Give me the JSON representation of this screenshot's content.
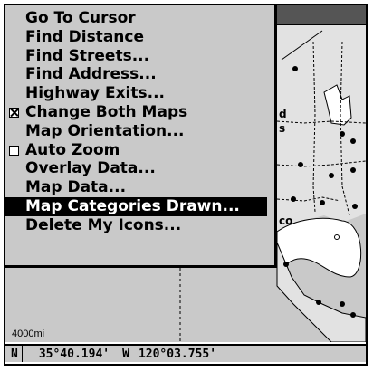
{
  "menu": {
    "items": [
      {
        "label": "Go To Cursor",
        "checkbox": null,
        "selected": false
      },
      {
        "label": "Find Distance",
        "checkbox": null,
        "selected": false
      },
      {
        "label": "Find Streets...",
        "checkbox": null,
        "selected": false
      },
      {
        "label": "Find Address...",
        "checkbox": null,
        "selected": false
      },
      {
        "label": "Highway Exits...",
        "checkbox": null,
        "selected": false
      },
      {
        "label": "Change Both Maps",
        "checkbox": true,
        "selected": false
      },
      {
        "label": "Map Orientation...",
        "checkbox": null,
        "selected": false
      },
      {
        "label": "Auto Zoom",
        "checkbox": false,
        "selected": false
      },
      {
        "label": "Overlay Data...",
        "checkbox": null,
        "selected": false
      },
      {
        "label": "Map Data...",
        "checkbox": null,
        "selected": false
      },
      {
        "label": "Map Categories Drawn...",
        "checkbox": null,
        "selected": true
      },
      {
        "label": "Delete My Icons...",
        "checkbox": null,
        "selected": false
      }
    ]
  },
  "map": {
    "scale_label": "4000mi",
    "fragments": [
      "d",
      "s",
      "co"
    ]
  },
  "status": {
    "lat_hemisphere": "N",
    "lat_value": "35°40.194'",
    "lon_hemisphere": "W",
    "lon_value": "120°03.755'"
  },
  "colors": {
    "background": "#c9c9c9",
    "highlight": "#000000",
    "text": "#000000"
  }
}
